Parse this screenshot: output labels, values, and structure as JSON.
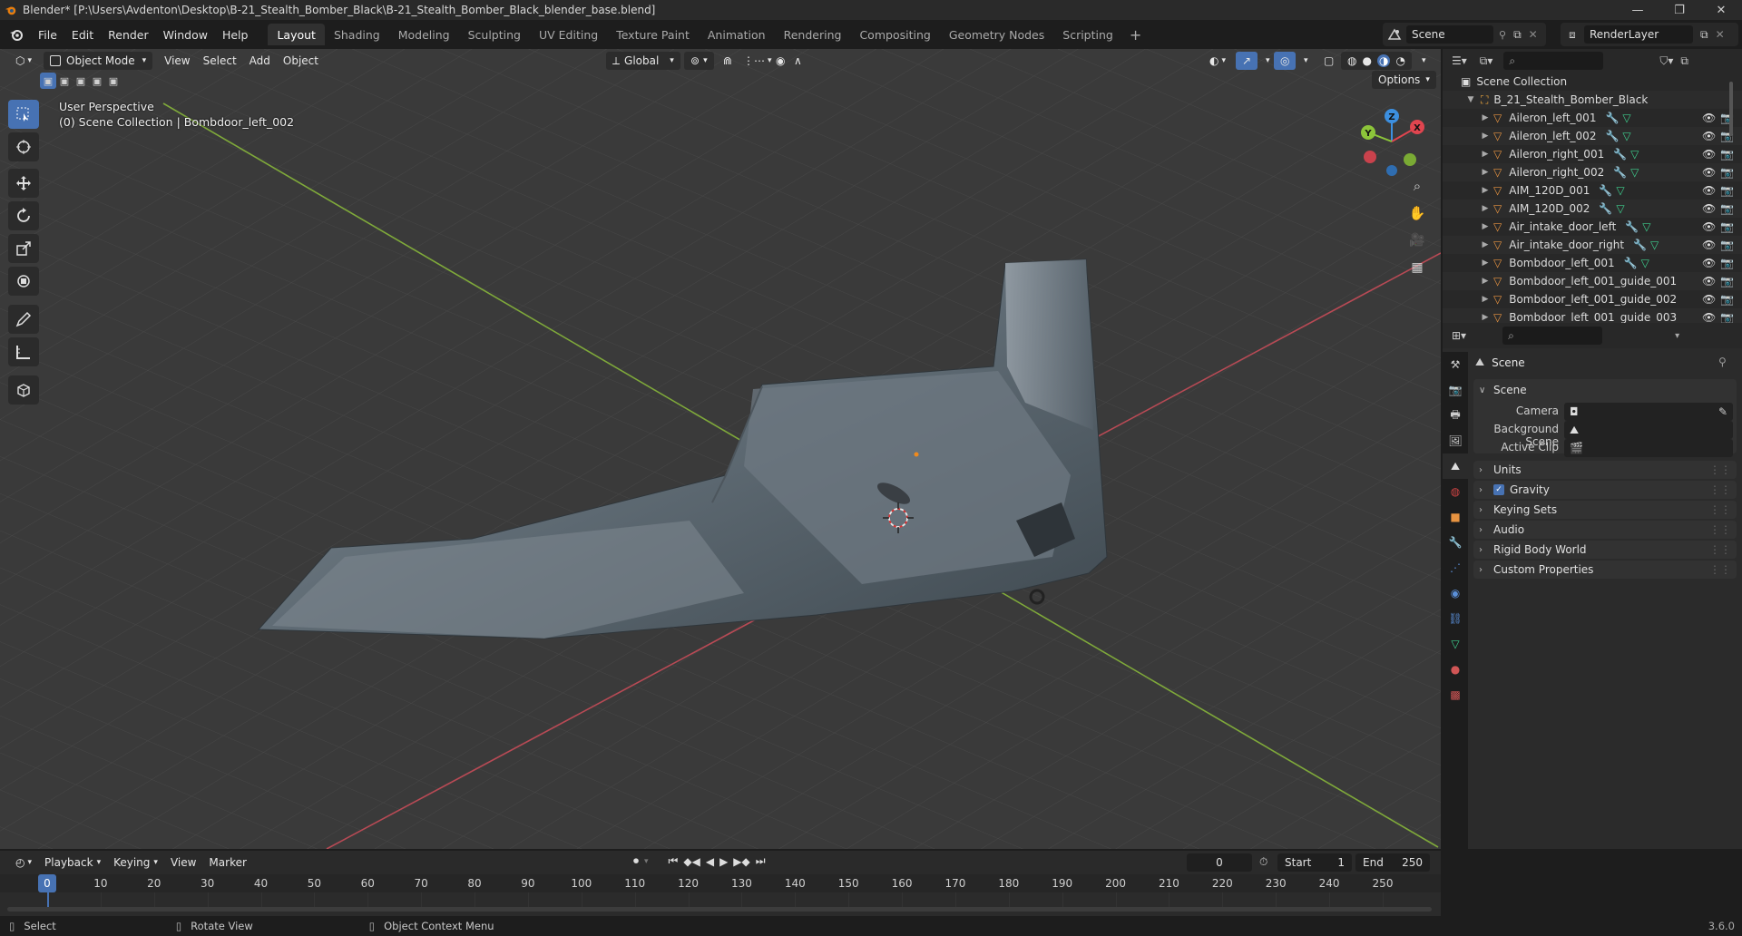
{
  "window": {
    "title": "Blender* [P:\\Users\\Avdenton\\Desktop\\B-21_Stealth_Bomber_Black\\B-21_Stealth_Bomber_Black_blender_base.blend]",
    "controls": {
      "minimize": "—",
      "maximize": "❐",
      "close": "✕"
    }
  },
  "menu": {
    "items": [
      "File",
      "Edit",
      "Render",
      "Window",
      "Help"
    ],
    "workspaces": [
      "Layout",
      "Shading",
      "Modeling",
      "Sculpting",
      "UV Editing",
      "Texture Paint",
      "Animation",
      "Rendering",
      "Compositing",
      "Geometry Nodes",
      "Scripting"
    ],
    "active_workspace": "Layout",
    "add_workspace": "+",
    "scene_name": "Scene",
    "view_layer": "RenderLayer"
  },
  "viewport": {
    "mode": "Object Mode",
    "menus": [
      "View",
      "Select",
      "Add",
      "Object"
    ],
    "orientation": "Global",
    "options_label": "Options",
    "perspective_label": "User Perspective",
    "collection_label": "(0) Scene Collection | Bombdoor_left_002",
    "gizmo_axes": {
      "x": "X",
      "y": "Y",
      "z": "Z"
    }
  },
  "outliner": {
    "root": "Scene Collection",
    "collection": "B_21_Stealth_Bomber_Black",
    "objects": [
      "Aileron_left_001",
      "Aileron_left_002",
      "Aileron_right_001",
      "Aileron_right_002",
      "AIM_120D_001",
      "AIM_120D_002",
      "Air_intake_door_left",
      "Air_intake_door_right",
      "Bombdoor_left_001",
      "Bombdoor_left_001_guide_001",
      "Bombdoor_left_001_guide_002",
      "Bombdoor_left_001_guide_003"
    ]
  },
  "properties": {
    "context_title": "Scene",
    "scene_panel": {
      "title": "Scene",
      "camera_label": "Camera",
      "background_scene_label": "Background Scene",
      "active_clip_label": "Active Clip"
    },
    "panels": [
      "Units",
      "Gravity",
      "Keying Sets",
      "Audio",
      "Rigid Body World",
      "Custom Properties"
    ],
    "gravity_checked": true
  },
  "timeline": {
    "menus": [
      "Playback",
      "Keying",
      "View",
      "Marker"
    ],
    "current_frame": "0",
    "start_label": "Start",
    "start_value": "1",
    "end_label": "End",
    "end_value": "250",
    "ticks": [
      "0",
      "10",
      "20",
      "30",
      "40",
      "50",
      "60",
      "70",
      "80",
      "90",
      "100",
      "110",
      "120",
      "130",
      "140",
      "150",
      "160",
      "170",
      "180",
      "190",
      "200",
      "210",
      "220",
      "230",
      "240",
      "250"
    ],
    "playhead_label": "0"
  },
  "statusbar": {
    "select": "Select",
    "rotate": "Rotate View",
    "context": "Object Context Menu",
    "version": "3.6.0"
  },
  "colors": {
    "accent": "#4772b3",
    "x_axis": "#e0454f",
    "y_axis": "#8cc43a",
    "z_axis": "#3c8fe0",
    "object_orange": "#e89441"
  }
}
